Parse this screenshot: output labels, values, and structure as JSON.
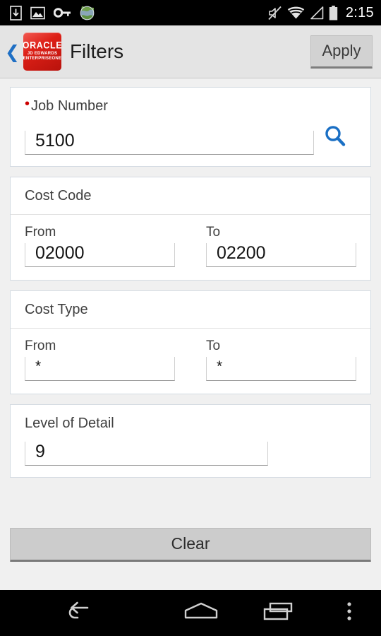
{
  "status_bar": {
    "icons_left": [
      "download-icon",
      "image-icon",
      "vpn-key-icon",
      "browser-globe-icon"
    ],
    "icons_right": [
      "volume-mute-icon",
      "wifi-icon",
      "cell-signal-icon",
      "battery-icon"
    ],
    "time": "2:15"
  },
  "header": {
    "back_label": "❮",
    "logo": {
      "brand": "ORACLE",
      "line2": "JD EDWARDS",
      "line3": "ENTERPRISEONE",
      "color": "#cc1a12"
    },
    "title": "Filters",
    "apply_label": "Apply"
  },
  "cards": {
    "job_number": {
      "label": "Job Number",
      "required": true,
      "required_marker": "•",
      "value": "5100",
      "search_icon": "search-icon",
      "search_icon_color": "#1a6fc4"
    },
    "cost_code": {
      "title": "Cost Code",
      "from_label": "From",
      "from_value": "02000",
      "to_label": "To",
      "to_value": "02200"
    },
    "cost_type": {
      "title": "Cost Type",
      "from_label": "From",
      "from_value": "*",
      "to_label": "To",
      "to_value": "*"
    },
    "level_of_detail": {
      "title": "Level of Detail",
      "value": "9"
    }
  },
  "footer": {
    "clear_label": "Clear"
  },
  "nav_bar": {
    "back": "back-icon",
    "home": "home-icon",
    "recents": "recents-icon",
    "menu": "overflow-menu-icon"
  },
  "colors": {
    "page_background": "#f0f0f0",
    "card_background": "#ffffff",
    "header_background": "#e4e4e4",
    "accent_blue": "#1a6fc4",
    "required_red": "#cc0000",
    "button_gray": "#cccccc"
  }
}
